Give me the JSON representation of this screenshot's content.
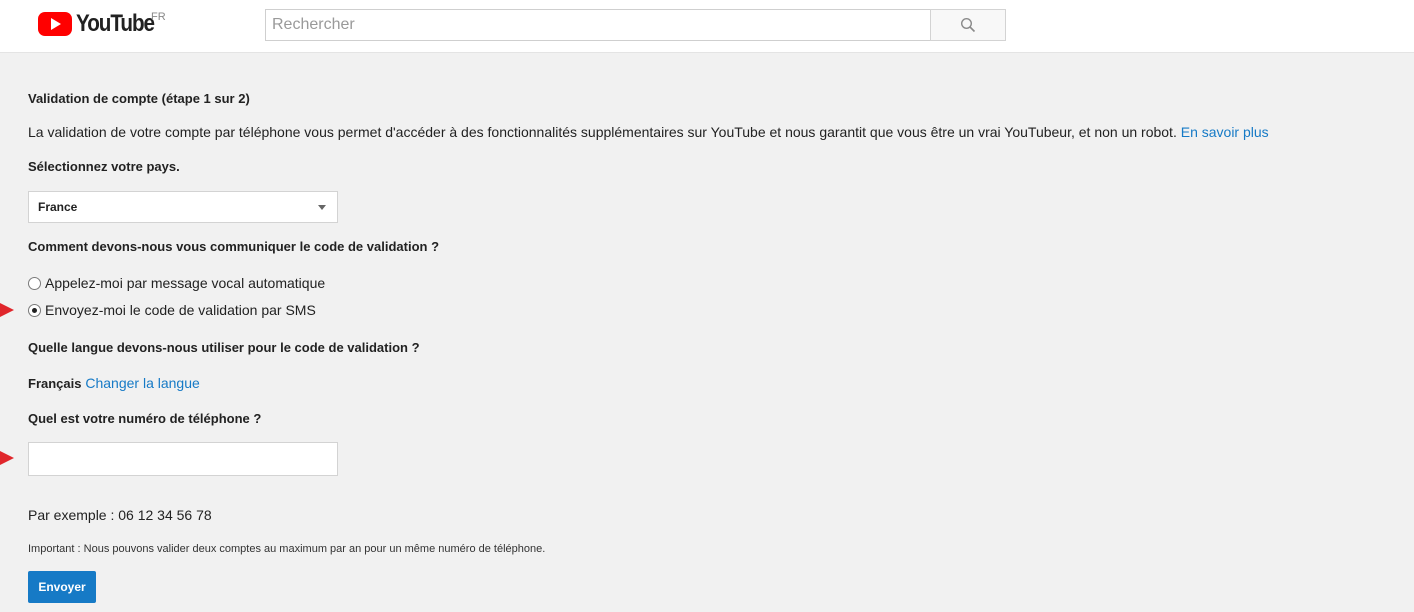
{
  "header": {
    "logo_text": "YouTube",
    "region": "FR",
    "search_placeholder": "Rechercher"
  },
  "form": {
    "title": "Validation de compte (étape 1 sur 2)",
    "intro": "La validation de votre compte par téléphone vous permet d'accéder à des fonctionnalités supplémentaires sur YouTube et nous garantit que vous être un vrai YouTubeur, et non un robot.",
    "learn_more": "En savoir plus",
    "country_label": "Sélectionnez votre pays.",
    "country_value": "France",
    "method_label": "Comment devons-nous vous communiquer le code de validation ?",
    "method_options": [
      {
        "label": "Appelez-moi par message vocal automatique",
        "checked": false
      },
      {
        "label": "Envoyez-moi le code de validation par SMS",
        "checked": true
      }
    ],
    "language_label": "Quelle langue devons-nous utiliser pour le code de validation ?",
    "language_value": "Français",
    "language_change": "Changer la langue",
    "phone_label": "Quel est votre numéro de téléphone ?",
    "phone_value": "",
    "example": "Par exemple : 06 12 34 56 78",
    "important_prefix": "Important :",
    "important_text": "Nous pouvons valider deux comptes au maximum par an pour un même numéro de téléphone.",
    "submit_label": "Envoyer"
  },
  "colors": {
    "brand_red": "#ff0000",
    "link": "#167ac6",
    "button": "#167ac6",
    "annotation_arrow": "#e0262b"
  },
  "icons": [
    "youtube-play-icon",
    "search-icon",
    "chevron-down-icon"
  ]
}
